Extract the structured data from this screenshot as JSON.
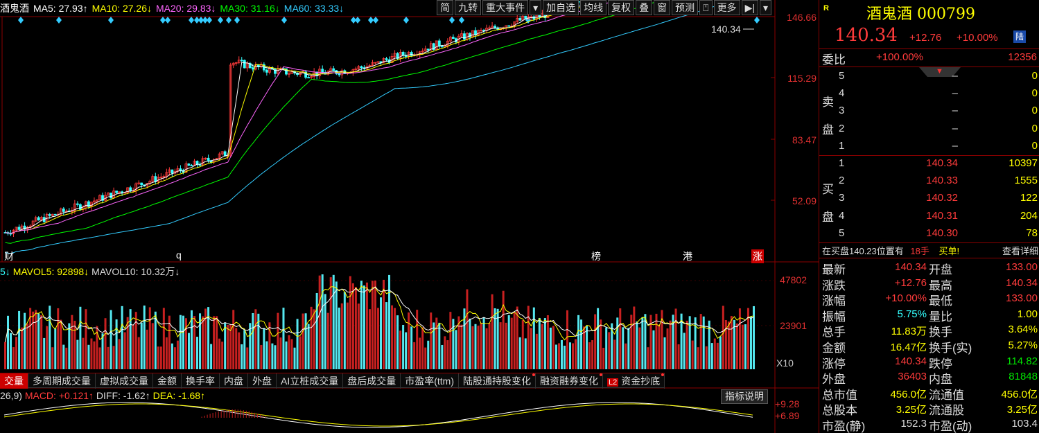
{
  "header": {
    "ma_line": [
      {
        "label": "酒鬼酒",
        "color": "#ffffff"
      },
      {
        "label": "MA5: 27.93↑",
        "color": "#ffffff"
      },
      {
        "label": "MA10: 27.26↓",
        "color": "#ffff00"
      },
      {
        "label": "MA20: 29.83↓",
        "color": "#ff66ff"
      },
      {
        "label": "MA30: 31.16↓",
        "color": "#00ff00"
      },
      {
        "label": "MA60: 33.33↓",
        "color": "#33ccff"
      }
    ],
    "toolbar": [
      "简",
      "九转",
      "重大事件",
      "▾",
      "加自选",
      "均线",
      "复权",
      "叠",
      "窗",
      "预测",
      "⍞",
      "更多",
      "▶|",
      "▾"
    ]
  },
  "price_axis": [
    "146.66",
    "115.29",
    "83.47",
    "52.09"
  ],
  "last_price_label": "140.34",
  "event_marks": [
    "财",
    "q",
    "榜",
    "港",
    "涨"
  ],
  "volume_header": {
    "prefix": "5↓",
    "mavol5": "MAVOL5: 92898↓",
    "mavol10": "MAVOL10: 10.32万↓"
  },
  "volume_axis": [
    "47802",
    "23901",
    "X10"
  ],
  "tabs": [
    {
      "label": "交量",
      "active": true,
      "dot": false
    },
    {
      "label": "多周期成交量",
      "active": false,
      "dot": false
    },
    {
      "label": "虚拟成交量",
      "active": false,
      "dot": false
    },
    {
      "label": "金额",
      "active": false,
      "dot": false
    },
    {
      "label": "换手率",
      "active": false,
      "dot": false
    },
    {
      "label": "内盘",
      "active": false,
      "dot": false
    },
    {
      "label": "外盘",
      "active": false,
      "dot": false
    },
    {
      "label": "AI立桩成交量",
      "active": false,
      "dot": false
    },
    {
      "label": "盘后成交量",
      "active": false,
      "dot": false
    },
    {
      "label": "市盈率(ttm)",
      "active": false,
      "dot": false
    },
    {
      "label": "陆股通持股变化",
      "active": false,
      "dot": true
    },
    {
      "label": "融资融券变化",
      "active": false,
      "dot": true
    },
    {
      "label": "资金抄底",
      "active": false,
      "dot": true,
      "badge": "L2"
    }
  ],
  "macd_header": {
    "prefix": "26,9)",
    "macd": "MACD: +0.121↑",
    "diff": "DIFF: -1.62↑",
    "dea": "DEA: -1.68↑",
    "explain": "指标说明"
  },
  "macd_axis": [
    "+9.28",
    "+6.89"
  ],
  "side": {
    "r_badge": "R",
    "name": "酒鬼酒",
    "code": "000799",
    "price": "140.34",
    "change": "+12.76",
    "pct": "+10.00%",
    "market_badge": "陆",
    "weibi_label": "委比",
    "weibi_value": "+100.00%",
    "weicha": "12356",
    "sell_label": [
      "卖",
      "盘"
    ],
    "sells": [
      {
        "lv": "5",
        "p": "–",
        "v": "0"
      },
      {
        "lv": "4",
        "p": "–",
        "v": "0"
      },
      {
        "lv": "3",
        "p": "–",
        "v": "0"
      },
      {
        "lv": "2",
        "p": "–",
        "v": "0"
      },
      {
        "lv": "1",
        "p": "–",
        "v": "0"
      }
    ],
    "buy_label": [
      "买",
      "盘"
    ],
    "buys": [
      {
        "lv": "1",
        "p": "140.34",
        "v": "10397"
      },
      {
        "lv": "2",
        "p": "140.33",
        "v": "1555"
      },
      {
        "lv": "3",
        "p": "140.32",
        "v": "122"
      },
      {
        "lv": "4",
        "p": "140.31",
        "v": "204"
      },
      {
        "lv": "5",
        "p": "140.30",
        "v": "78"
      }
    ],
    "notice": {
      "text": "在买盘140.23位置有",
      "hands": "18手",
      "buy": "买单!",
      "detail": "查看详细"
    },
    "stats": [
      {
        "l1": "最新",
        "v1": "140.34",
        "c1": "red",
        "l2": "开盘",
        "v2": "133.00",
        "c2": "red"
      },
      {
        "l1": "涨跌",
        "v1": "+12.76",
        "c1": "red",
        "l2": "最高",
        "v2": "140.34",
        "c2": "red"
      },
      {
        "l1": "涨幅",
        "v1": "+10.00%",
        "c1": "red",
        "l2": "最低",
        "v2": "133.00",
        "c2": "red"
      },
      {
        "l1": "振幅",
        "v1": "5.75%",
        "c1": "cyan",
        "l2": "量比",
        "v2": "1.00",
        "c2": "yellow"
      },
      {
        "l1": "总手",
        "v1": "11.83万",
        "c1": "yellow",
        "l2": "换手",
        "v2": "3.64%",
        "c2": "yellow"
      },
      {
        "l1": "金额",
        "v1": "16.47亿",
        "c1": "yellow",
        "l2": "换手(实)",
        "v2": "5.27%",
        "c2": "yellow"
      },
      {
        "l1": "涨停",
        "v1": "140.34",
        "c1": "red",
        "l2": "跌停",
        "v2": "114.82",
        "c2": "green"
      },
      {
        "l1": "外盘",
        "v1": "36403",
        "c1": "red",
        "l2": "内盘",
        "v2": "81848",
        "c2": "green"
      },
      {
        "l1": "总市值",
        "v1": "456.0亿",
        "c1": "yellow",
        "l2": "流通值",
        "v2": "456.0亿",
        "c2": "yellow"
      },
      {
        "l1": "总股本",
        "v1": "3.25亿",
        "c1": "yellow",
        "l2": "流通股",
        "v2": "3.25亿",
        "c2": "yellow"
      },
      {
        "l1": "市盈(静)",
        "v1": "152.3",
        "c1": "white",
        "l2": "市盈(动)",
        "v2": "103.4",
        "c2": "white"
      }
    ]
  },
  "colors": {
    "up": "#ff3b3b",
    "down": "#33ffff",
    "ma5": "#ffffff",
    "ma10": "#ffff00",
    "ma20": "#ff66ff",
    "ma30": "#00ff00",
    "ma60": "#33ccff"
  }
}
